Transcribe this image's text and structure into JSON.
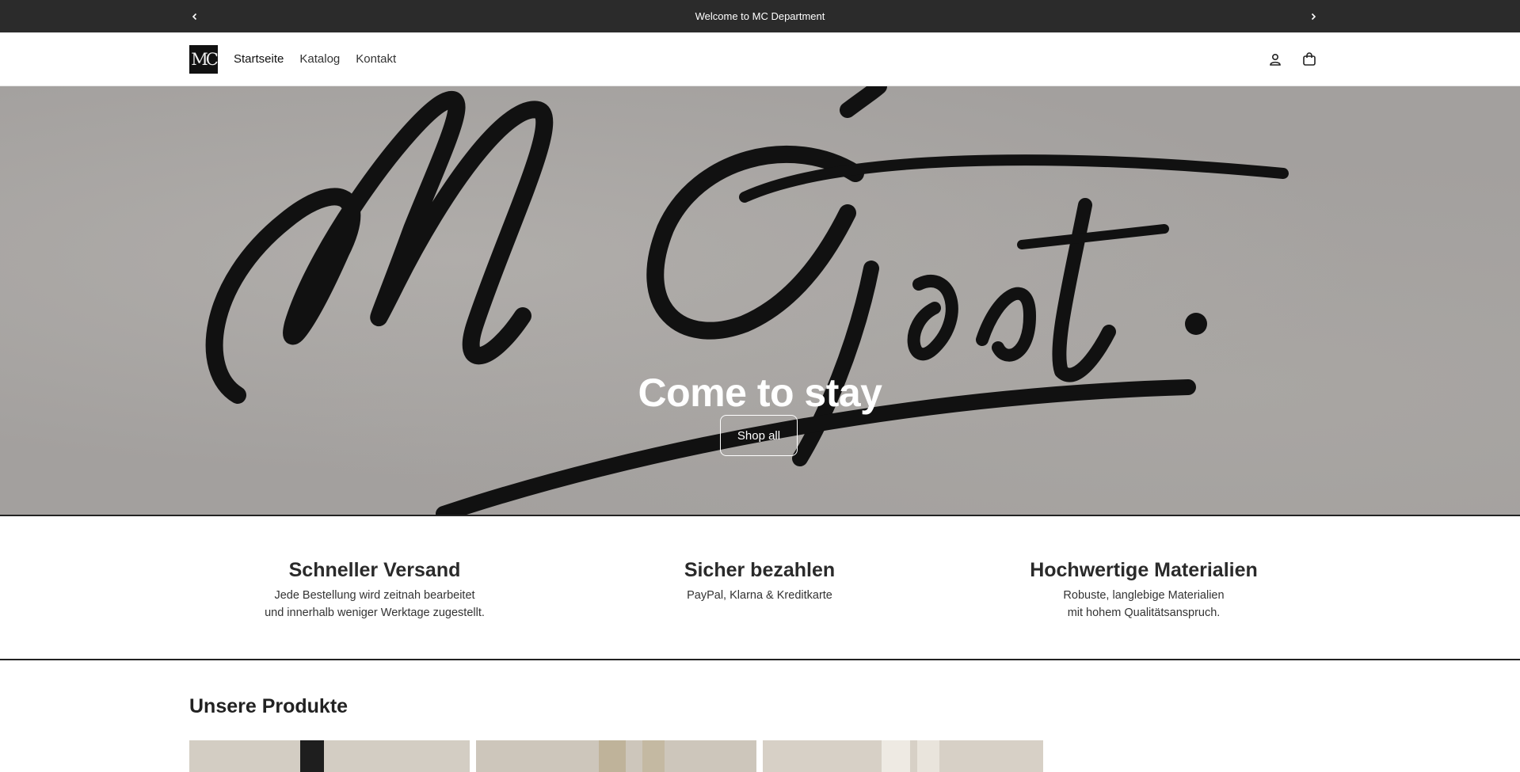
{
  "announcement": {
    "text": "Welcome to MC Department"
  },
  "header": {
    "logo_alt": "MC",
    "nav": [
      {
        "label": "Startseite"
      },
      {
        "label": "Katalog"
      },
      {
        "label": "Kontakt"
      }
    ],
    "icons": {
      "account": "account-icon",
      "cart": "cart-icon"
    }
  },
  "hero": {
    "title": "Come to stay",
    "button": "Shop all"
  },
  "features": [
    {
      "title": "Schneller Versand",
      "line1": "Jede Bestellung wird zeitnah bearbeitet",
      "line2": "und innerhalb weniger Werktage zugestellt."
    },
    {
      "title": "Sicher bezahlen",
      "line1": "PayPal, Klarna & Kreditkarte",
      "line2": ""
    },
    {
      "title": "Hochwertige Materialien",
      "line1": "Robuste, langlebige Materialien",
      "line2": "mit hohem Qualitätsanspruch."
    }
  ],
  "products": {
    "title": "Unsere Produkte"
  },
  "colors": {
    "announce_bg": "#2b2b2b",
    "hero_bg": "#a3a09e",
    "text": "#222222"
  }
}
